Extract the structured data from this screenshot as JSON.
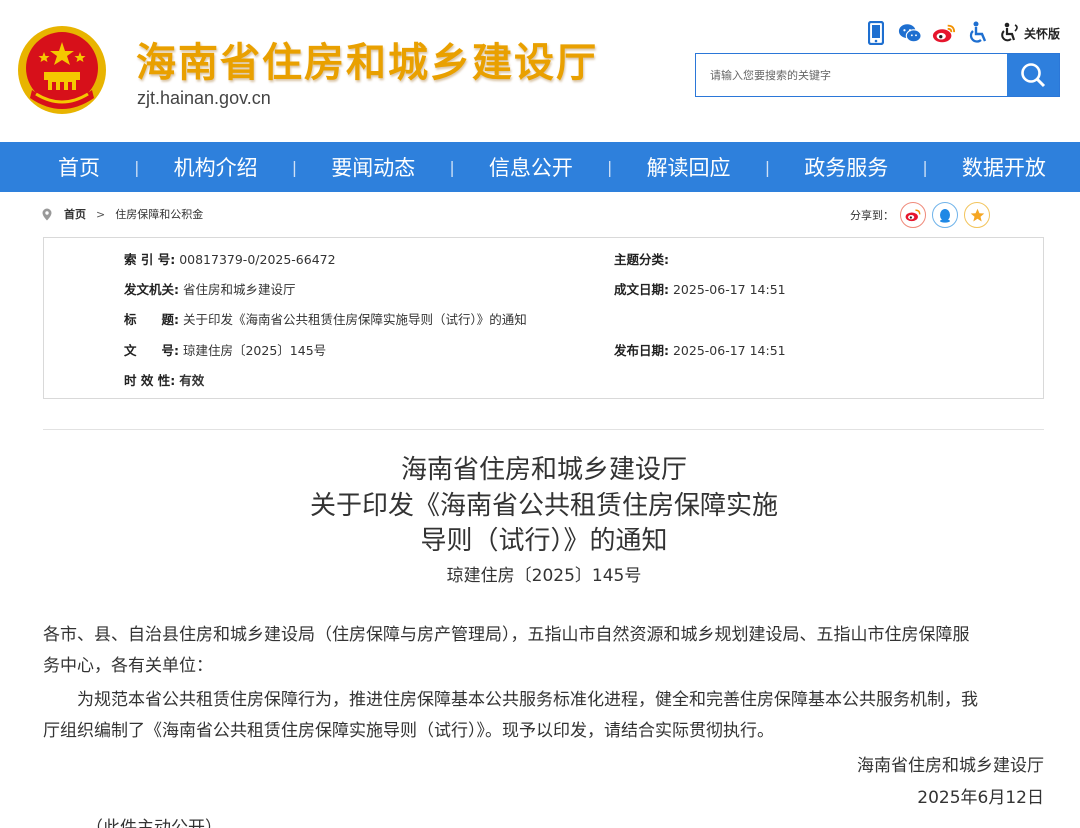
{
  "site": {
    "name": "海南省住房和城乡建设厅",
    "domain": "zjt.hainan.gov.cn",
    "care_mode_label": "关怀版"
  },
  "search": {
    "placeholder": "请输入您要搜索的关键字"
  },
  "nav": [
    "首页",
    "机构介绍",
    "要闻动态",
    "信息公开",
    "解读回应",
    "政务服务",
    "数据开放"
  ],
  "breadcrumb": {
    "home": "首页",
    "current": "住房保障和公积金"
  },
  "share": {
    "label": "分享到："
  },
  "info": {
    "index_key": "索 引 号:",
    "index_val": "00817379-0/2025-66472",
    "topic_key": "主题分类:",
    "topic_val": "",
    "issuer_key": "发文机关:",
    "issuer_val": "省住房和城乡建设厅",
    "created_key": "成文日期:",
    "created_val": "2025-06-17 14:51",
    "title_key": "标　　题:",
    "title_val": "关于印发《海南省公共租赁住房保障实施导则（试行）》的通知",
    "docno_key": "文　　号:",
    "docno_val": "琼建住房〔2025〕145号",
    "published_key": "发布日期:",
    "published_val": "2025-06-17 14:51",
    "validity_key": "时 效 性:",
    "validity_val": "有效"
  },
  "article": {
    "title_line1": "海南省住房和城乡建设厅",
    "title_line2": "关于印发《海南省公共租赁住房保障实施",
    "title_line3": "导则（试行）》的通知",
    "doc_number": "琼建住房〔2025〕145号",
    "para1_line1": "各市、县、自治县住房和城乡建设局（住房保障与房产管理局），五指山市自然资源和城乡规划建设局、五指山市住房保障服",
    "para1_line2": "务中心，各有关单位：",
    "para2_line1": "　　为规范本省公共租赁住房保障行为，推进住房保障基本公共服务标准化进程，健全和完善住房保障基本公共服务机制，我",
    "para2_line2": "厅组织编制了《海南省公共租赁住房保障实施导则（试行）》。现予以印发，请结合实际贯彻执行。",
    "signer": "海南省住房和城乡建设厅",
    "sign_date": "2025年6月12日",
    "footnote": "（此件主动公开）"
  },
  "colors": {
    "brand_blue": "#2e80dc",
    "title_gold": "#e9a000",
    "emblem_red": "#d7101a"
  }
}
